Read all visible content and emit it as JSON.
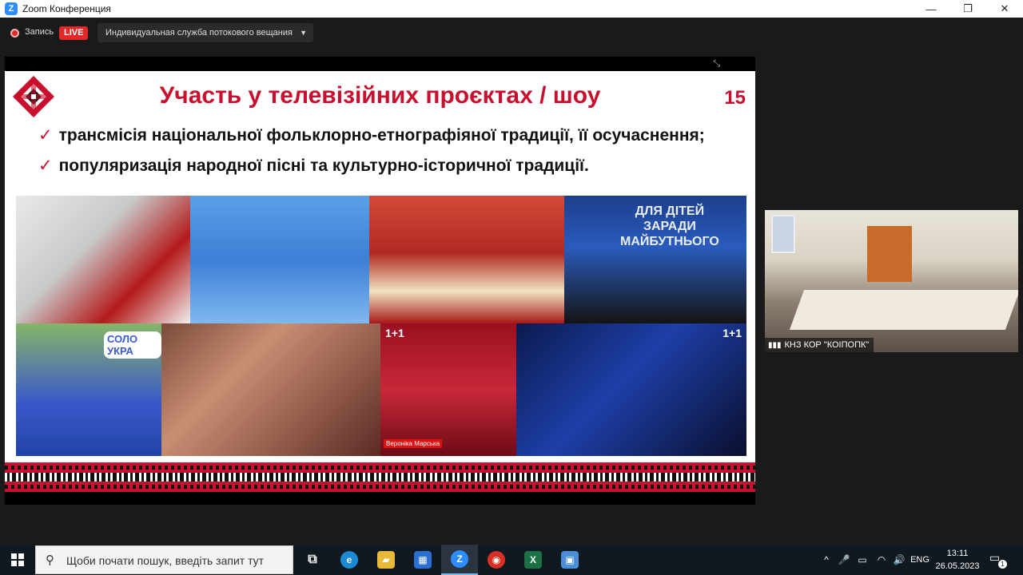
{
  "window": {
    "title": "Zoom Конференция",
    "logo_letter": "Z",
    "controls": {
      "minimize": "—",
      "maximize": "❐",
      "close": "✕"
    }
  },
  "recording_bar": {
    "record_label": "Запись",
    "live_badge": "LIVE",
    "stream_service": "Индивидуальная служба потокового вещания",
    "dropdown_arrow": "▼"
  },
  "slide": {
    "title": "Участь у телевізійних проєктах / шоу",
    "number": "15",
    "bullets": [
      "трансмісія національної фольклорно-етнографіяної традиції, її осучаснення;",
      "популяризація народної пісні та культурно-історичної традиції."
    ],
    "check_mark": "✓",
    "photo_texts": {
      "p4": "ДЛЯ ДІТЕЙ\nЗАРАДИ\nМАЙБУТНЬОГО",
      "p5": "СОЛО УКРА",
      "p7": "1+1",
      "p7_name": "Вероніка Марська",
      "p8": "1+1"
    }
  },
  "participant": {
    "name": "КНЗ КОР \"КОІПОПК\"",
    "signal_icon": "signal-bars-icon"
  },
  "taskbar": {
    "search_placeholder": "Щоби почати пошук, введіть запит тут",
    "search_icon_glyph": "⚲",
    "apps": [
      {
        "name": "task-view-icon",
        "glyph": "⧉",
        "color": "#101820"
      },
      {
        "name": "edge-icon",
        "glyph": "e",
        "color": "#1a8ad4"
      },
      {
        "name": "file-explorer-icon",
        "glyph": "▰",
        "color": "#e9b93a"
      },
      {
        "name": "store-icon",
        "glyph": "▦",
        "color": "#2a6fd1"
      },
      {
        "name": "zoom-icon",
        "glyph": "Z",
        "color": "#2d8cff"
      },
      {
        "name": "chrome-icon",
        "glyph": "◉",
        "color": "#d93025"
      },
      {
        "name": "excel-icon",
        "glyph": "X",
        "color": "#1d7044"
      },
      {
        "name": "photos-icon",
        "glyph": "▣",
        "color": "#4a8fd8"
      }
    ],
    "tray": {
      "chevron": "^",
      "mic": "🎤",
      "battery": "▭",
      "wifi": "◠",
      "volume": "🔊",
      "language": "ENG"
    },
    "time": "13:11",
    "date": "26.05.2023",
    "notification_count": "1",
    "notification_glyph": "▭"
  },
  "colors": {
    "slide_accent": "#c8102e",
    "zoom_blue": "#2d8cff",
    "live_red": "#e02828"
  }
}
